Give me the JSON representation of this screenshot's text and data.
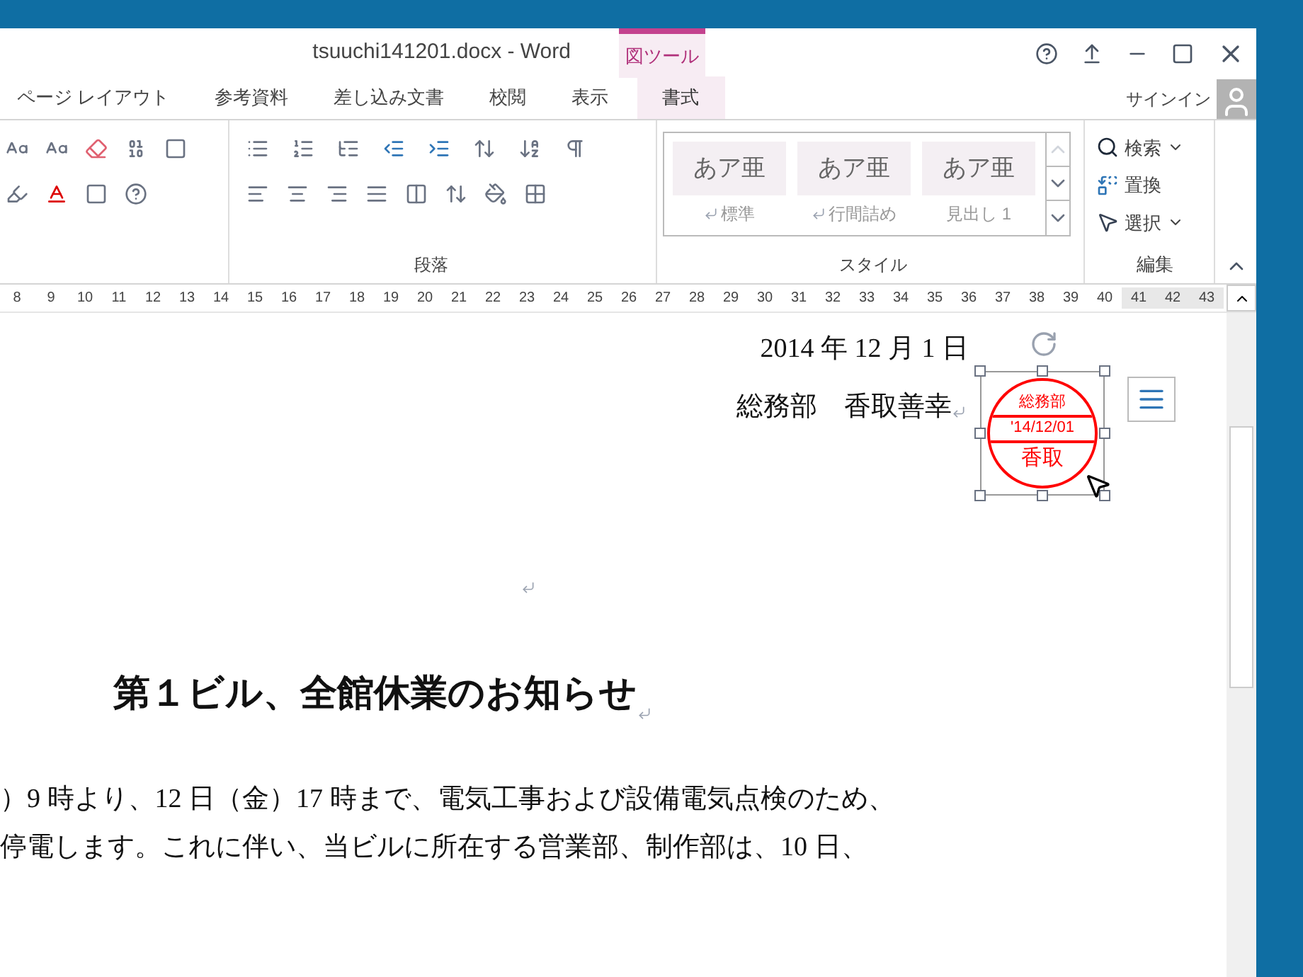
{
  "window": {
    "title": "tsuuchi141201.docx - Word",
    "context_header": "図ツール",
    "account": "サインイン"
  },
  "tabs": [
    {
      "label": "ページ レイアウト",
      "kind": "normal"
    },
    {
      "label": "参考資料",
      "kind": "normal"
    },
    {
      "label": "差し込み文書",
      "kind": "normal"
    },
    {
      "label": "校閲",
      "kind": "normal"
    },
    {
      "label": "表示",
      "kind": "normal"
    },
    {
      "label": "書式",
      "kind": "context"
    }
  ],
  "ribbon": {
    "paragraph_label": "段落",
    "styles_label": "スタイル",
    "editing_label": "編集",
    "styles": [
      {
        "preview": "あア亜",
        "name": "標準",
        "mark": true
      },
      {
        "preview": "あア亜",
        "name": "行間詰め",
        "mark": true
      },
      {
        "preview": "あア亜",
        "name": "見出し 1",
        "mark": false
      }
    ],
    "editing": [
      {
        "label": "検索",
        "kind": "find",
        "dropdown": true
      },
      {
        "label": "置換",
        "kind": "replace",
        "dropdown": false
      },
      {
        "label": "選択",
        "kind": "select",
        "dropdown": true
      }
    ]
  },
  "ruler": [
    "8",
    "9",
    "10",
    "11",
    "12",
    "13",
    "14",
    "15",
    "16",
    "17",
    "18",
    "19",
    "20",
    "21",
    "22",
    "23",
    "24",
    "25",
    "26",
    "27",
    "28",
    "29",
    "30",
    "31",
    "32",
    "33",
    "34",
    "35",
    "36",
    "37",
    "38",
    "39",
    "40",
    "41",
    "42",
    "43"
  ],
  "document": {
    "date": "2014 年 12 月 1 日",
    "sender": "総務部　香取善幸",
    "heading": "第１ビル、全館休業のお知らせ",
    "stamp": {
      "top": "総務部",
      "middle": "'14/12/01",
      "bottom": "香取"
    },
    "body": [
      "）9 時より、12 日（金）17 時まで、電気工事および設備電気点検のため、",
      "停電します。これに伴い、当ビルに所在する営業部、制作部は、10 日、"
    ]
  }
}
